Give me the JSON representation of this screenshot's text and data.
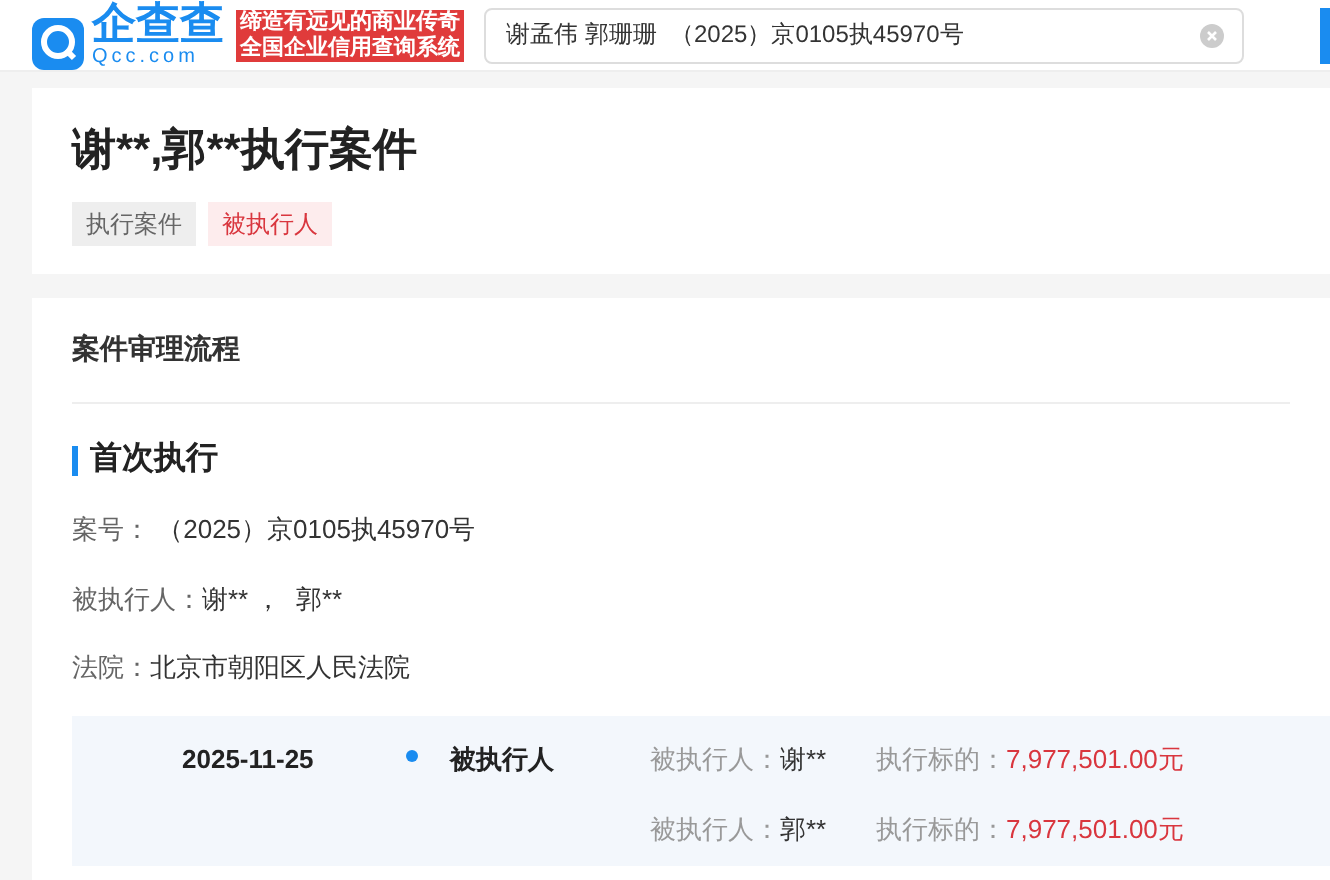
{
  "header": {
    "logo_name": "企查查",
    "logo_domain": "Qcc.com",
    "slogan_lines": [
      "缔造有远见的商业传奇",
      "全国企业信用查询系统"
    ],
    "search": {
      "value": "谢孟伟 郭珊珊  （2025）京0105执45970号"
    }
  },
  "case": {
    "title": "谢**,郭**执行案件",
    "tags": [
      {
        "label": "执行案件",
        "kind": "neutral"
      },
      {
        "label": "被执行人",
        "kind": "alert"
      }
    ]
  },
  "process": {
    "title": "案件审理流程",
    "stage": {
      "title": "首次执行",
      "fields": [
        {
          "label": "案号：",
          "value": " （2025）京0105执45970号"
        },
        {
          "label": "被执行人：",
          "value": "谢** ，  郭**"
        },
        {
          "label": "法院：",
          "value": "北京市朝阳区人民法院"
        }
      ],
      "timeline": [
        {
          "date": "2025-11-25",
          "role": "被执行人",
          "entries": [
            {
              "person_label": "被执行人：",
              "person": "谢**",
              "amount_label": "执行标的：",
              "amount": "7,977,501.00元"
            },
            {
              "person_label": "被执行人：",
              "person": "郭**",
              "amount_label": "执行标的：",
              "amount": "7,977,501.00元"
            }
          ]
        }
      ]
    }
  }
}
